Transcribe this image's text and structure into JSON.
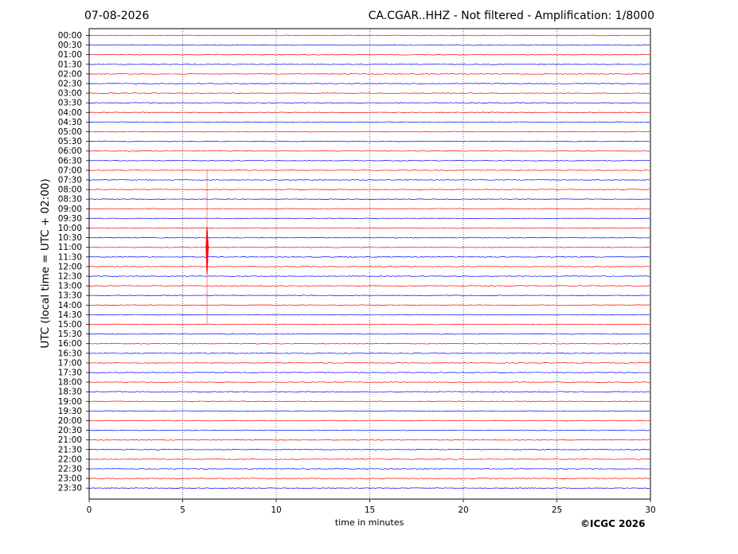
{
  "header": {
    "date": "07-08-2026",
    "title": "CA.CGAR..HHZ - Not filtered - Amplification: 1/8000"
  },
  "footer": {
    "copyright": "©ICGC 2026"
  },
  "chart_data": {
    "type": "line",
    "subtype": "helicorder",
    "title": "CA.CGAR..HHZ - Not filtered - Amplification: 1/8000",
    "xlabel": "time in minutes",
    "ylabel": "UTC (local time = UTC + 02:00)",
    "xlim": [
      0,
      30
    ],
    "x_ticks": [
      "0",
      "5",
      "10",
      "15",
      "20",
      "25",
      "30"
    ],
    "x_tick_values": [
      0,
      5,
      10,
      15,
      20,
      25,
      30
    ],
    "grid": "vertical dotted lines at each x tick",
    "row_labels": [
      "00:00",
      "00:30",
      "01:00",
      "01:30",
      "02:00",
      "02:30",
      "03:00",
      "03:30",
      "04:00",
      "04:30",
      "05:00",
      "05:30",
      "06:00",
      "06:30",
      "07:00",
      "07:30",
      "08:00",
      "08:30",
      "09:00",
      "09:30",
      "10:00",
      "10:30",
      "11:00",
      "11:30",
      "12:00",
      "12:30",
      "13:00",
      "13:30",
      "14:00",
      "14:30",
      "15:00",
      "15:30",
      "16:00",
      "16:30",
      "17:00",
      "17:30",
      "18:00",
      "18:30",
      "19:00",
      "19:30",
      "20:00",
      "20:30",
      "21:00",
      "21:30",
      "22:00",
      "22:30",
      "23:00",
      "23:30"
    ],
    "trace_colors": [
      "#ff0000",
      "#0000ff"
    ],
    "event": {
      "row_label": "11:00",
      "x_minutes": 6.3,
      "color": "#ff0000",
      "peak_amplitude_rows": 8
    }
  }
}
